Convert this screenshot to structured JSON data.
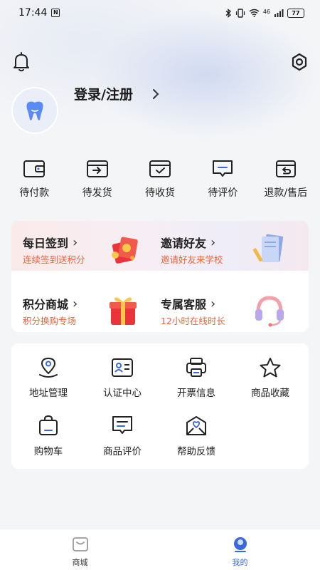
{
  "status_bar": {
    "time": "17:44",
    "nfc": "N",
    "signal_text": "46",
    "battery": "77"
  },
  "header": {
    "login_label": "登录/注册",
    "arrow": "›"
  },
  "orders": [
    {
      "label": "待付款",
      "icon": "wallet-icon"
    },
    {
      "label": "待发货",
      "icon": "box-arrow-icon"
    },
    {
      "label": "待收货",
      "icon": "box-check-icon"
    },
    {
      "label": "待评价",
      "icon": "comment-icon"
    },
    {
      "label": "退款/售后",
      "icon": "return-box-icon"
    }
  ],
  "promos": [
    {
      "title": "每日签到",
      "subtitle": "连续签到送积分",
      "icon": "red-envelope-icon"
    },
    {
      "title": "邀请好友",
      "subtitle": "邀请好友来学校",
      "icon": "notebook-icon"
    },
    {
      "title": "积分商城",
      "subtitle": "积分换购专场",
      "icon": "gift-box-icon"
    },
    {
      "title": "专属客服",
      "subtitle": "12小时在线时长",
      "icon": "headset-icon"
    }
  ],
  "menu": [
    {
      "label": "地址管理",
      "icon": "location-icon"
    },
    {
      "label": "认证中心",
      "icon": "id-card-icon"
    },
    {
      "label": "开票信息",
      "icon": "printer-icon"
    },
    {
      "label": "商品收藏",
      "icon": "star-icon"
    },
    {
      "label": "购物车",
      "icon": "shopping-bag-icon"
    },
    {
      "label": "商品评价",
      "icon": "review-icon"
    },
    {
      "label": "帮助反馈",
      "icon": "feedback-icon"
    }
  ],
  "tabbar": [
    {
      "label": "商城",
      "icon": "shop-icon",
      "active": false
    },
    {
      "label": "我的",
      "icon": "profile-icon",
      "active": true
    }
  ],
  "colors": {
    "accent": "#3a66e0",
    "promo_subtitle": "#e8643c",
    "background": "#f4f5f7"
  }
}
